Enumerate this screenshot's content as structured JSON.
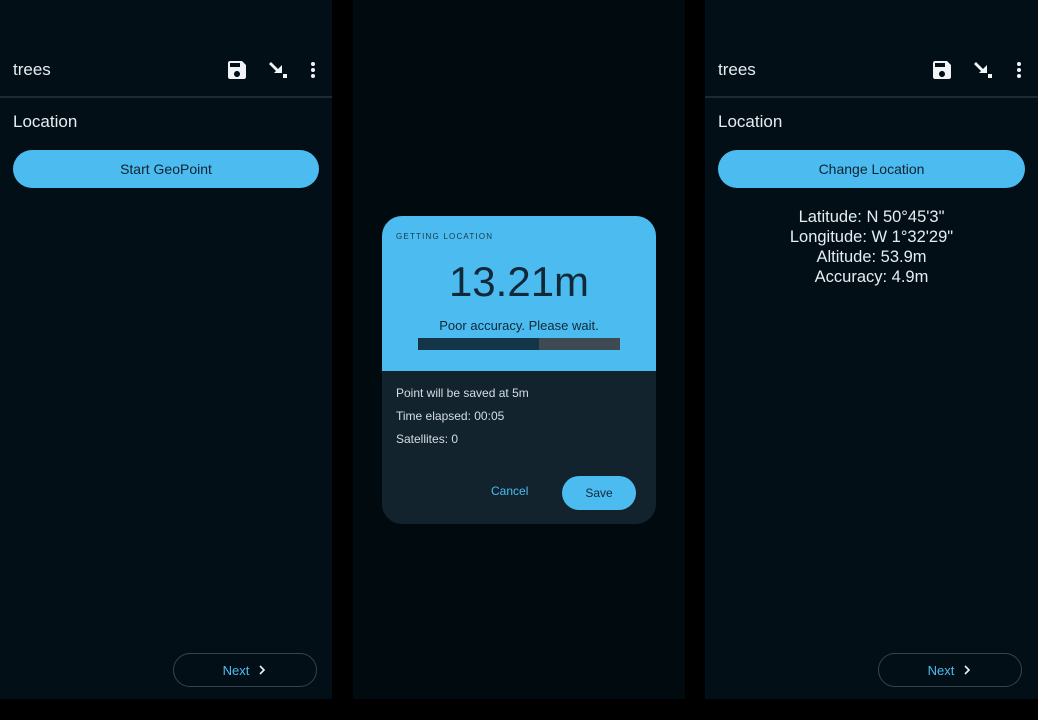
{
  "screens": {
    "form_before": {
      "app_title": "trees",
      "section_title": "Location",
      "primary_button": "Start GeoPoint",
      "next_button": "Next"
    },
    "geopoint_dialog": {
      "caption": "GETTING LOCATION",
      "accuracy": "13.21m",
      "status": "Poor accuracy. Please wait.",
      "progress": 0.6,
      "save_threshold": "Point will be saved at 5m",
      "time_elapsed": "Time elapsed: 00:05",
      "satellites": "Satellites: 0",
      "cancel_button": "Cancel",
      "save_button": "Save"
    },
    "form_after": {
      "app_title": "trees",
      "section_title": "Location",
      "primary_button": "Change Location",
      "latitude": "Latitude: N 50°45'3\"",
      "longitude": "Longitude: W 1°32'29\"",
      "altitude": "Altitude: 53.9m",
      "accuracy": "Accuracy: 4.9m",
      "next_button": "Next"
    }
  },
  "icons": {
    "save": "save-icon",
    "go_to_end": "go-to-end-icon",
    "overflow": "more-vert-icon",
    "next": "chevron-right-icon"
  },
  "colors": {
    "accent": "#4cbcf0",
    "background": "#020f16",
    "dialog_body": "#13232e",
    "text_primary": "#e6edf2"
  }
}
